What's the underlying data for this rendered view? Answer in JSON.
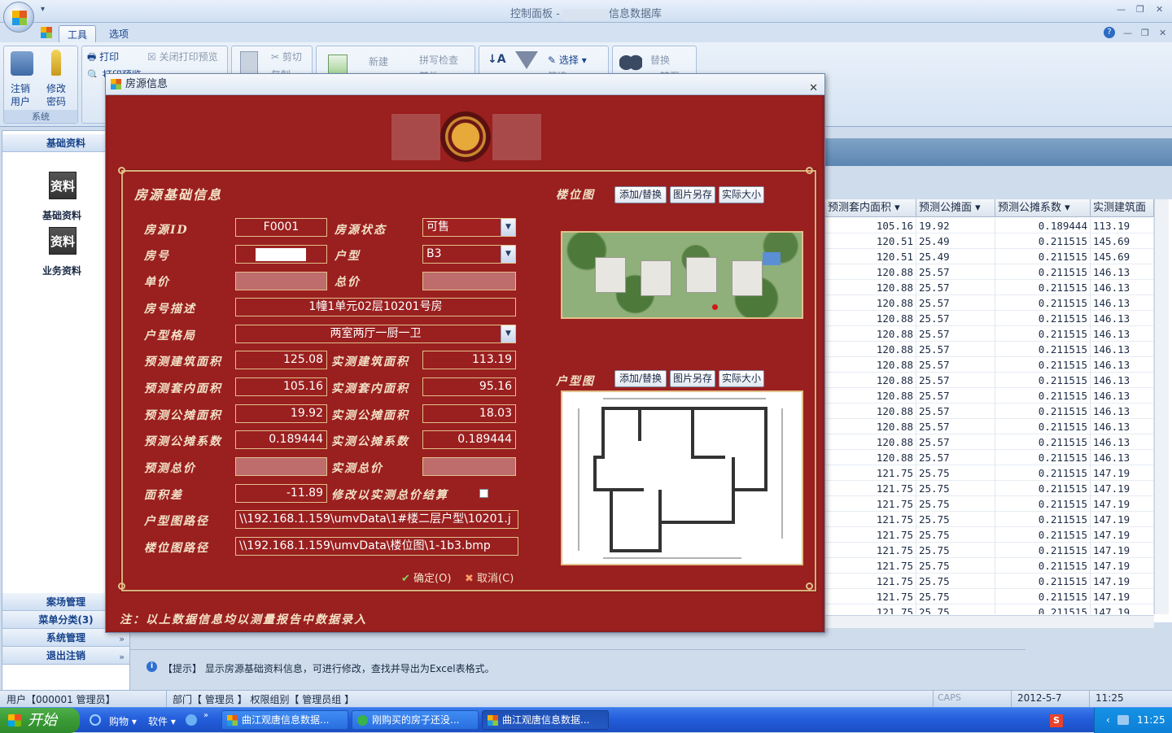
{
  "app": {
    "title_prefix": "控制面板 - ",
    "title_suffix": "信息数据库"
  },
  "tabs": [
    {
      "label": "工具"
    },
    {
      "label": "选项"
    }
  ],
  "ribbon": {
    "system_group": {
      "label": "系统",
      "logout": "注销\n用户",
      "change_pwd": "修改\n密码"
    },
    "print": "打印",
    "close_preview": "关闭打印预览",
    "preview": "打印预览",
    "cut": "剪切",
    "copy": "复制",
    "new": "新建",
    "spell": "拼写检查",
    "other": "其他",
    "select": "选择",
    "filter": "筛选",
    "replace": "替换",
    "goto": "转至"
  },
  "nav": {
    "header": "基础资料",
    "icon_text": "资料",
    "item1": "基础资料",
    "item2": "业务资料",
    "bottom": [
      {
        "label": "案场管理"
      },
      {
        "label": "菜单分类(3)"
      },
      {
        "label": "系统管理"
      },
      {
        "label": "退出注销"
      }
    ]
  },
  "grid": {
    "headers": [
      "预测套内面积",
      "预测公摊面",
      "预测公摊系数",
      "实测建筑面"
    ],
    "rows": [
      [
        "105.16",
        "19.92",
        "0.189444",
        "113.19"
      ],
      [
        "120.51",
        "25.49",
        "0.211515",
        "145.69"
      ],
      [
        "120.51",
        "25.49",
        "0.211515",
        "145.69"
      ],
      [
        "120.88",
        "25.57",
        "0.211515",
        "146.13"
      ],
      [
        "120.88",
        "25.57",
        "0.211515",
        "146.13"
      ],
      [
        "120.88",
        "25.57",
        "0.211515",
        "146.13"
      ],
      [
        "120.88",
        "25.57",
        "0.211515",
        "146.13"
      ],
      [
        "120.88",
        "25.57",
        "0.211515",
        "146.13"
      ],
      [
        "120.88",
        "25.57",
        "0.211515",
        "146.13"
      ],
      [
        "120.88",
        "25.57",
        "0.211515",
        "146.13"
      ],
      [
        "120.88",
        "25.57",
        "0.211515",
        "146.13"
      ],
      [
        "120.88",
        "25.57",
        "0.211515",
        "146.13"
      ],
      [
        "120.88",
        "25.57",
        "0.211515",
        "146.13"
      ],
      [
        "120.88",
        "25.57",
        "0.211515",
        "146.13"
      ],
      [
        "120.88",
        "25.57",
        "0.211515",
        "146.13"
      ],
      [
        "120.88",
        "25.57",
        "0.211515",
        "146.13"
      ],
      [
        "121.75",
        "25.75",
        "0.211515",
        "147.19"
      ],
      [
        "121.75",
        "25.75",
        "0.211515",
        "147.19"
      ],
      [
        "121.75",
        "25.75",
        "0.211515",
        "147.19"
      ],
      [
        "121.75",
        "25.75",
        "0.211515",
        "147.19"
      ],
      [
        "121.75",
        "25.75",
        "0.211515",
        "147.19"
      ],
      [
        "121.75",
        "25.75",
        "0.211515",
        "147.19"
      ],
      [
        "121.75",
        "25.75",
        "0.211515",
        "147.19"
      ],
      [
        "121.75",
        "25.75",
        "0.211515",
        "147.19"
      ],
      [
        "121.75",
        "25.75",
        "0.211515",
        "147.19"
      ],
      [
        "121.75",
        "25.75",
        "0.211515",
        "147.19"
      ]
    ]
  },
  "hint": "【提示】 显示房源基础资料信息，可进行修改，查找并导出为Excel表格式。",
  "status": {
    "user": "用户【000001 管理员】",
    "dept": "部门【 管理员 】 权限组别【 管理员组 】",
    "caps": "CAPS",
    "date": "2012-5-7",
    "time": "11:25"
  },
  "taskbar": {
    "start": "开始",
    "quick1": "购物",
    "quick2": "软件",
    "tasks": [
      {
        "label": "曲江观唐信息数据..."
      },
      {
        "label": "刚购买的房子还没..."
      },
      {
        "label": "曲江观唐信息数据..."
      }
    ],
    "clock": "11:25"
  },
  "dialog": {
    "title": "房源信息",
    "section": "房源基础信息",
    "labels": {
      "id": "房源ID",
      "status": "房源状态",
      "room_no": "房号",
      "layout_type": "户型",
      "unit_price": "单价",
      "total_price": "总价",
      "desc": "房号描述",
      "layout": "户型格局",
      "pred_build": "预测建筑面积",
      "real_build": "实测建筑面积",
      "pred_inner": "预测套内面积",
      "real_inner": "实测套内面积",
      "pred_share": "预测公摊面积",
      "real_share": "实测公摊面积",
      "pred_coef": "预测公摊系数",
      "real_coef": "实测公摊系数",
      "pred_total": "预测总价",
      "real_total": "实测总价",
      "area_diff": "面积差",
      "settle_check": "修改以实测总价结算",
      "layout_path": "户型图路径",
      "site_path": "楼位图路径"
    },
    "values": {
      "id": "F0001",
      "status": "可售",
      "layout_type": "B3",
      "desc": "1幢1单元02层10201号房",
      "layout": "两室两厅一厨一卫",
      "pred_build": "125.08",
      "real_build": "113.19",
      "pred_inner": "105.16",
      "real_inner": "95.16",
      "pred_share": "19.92",
      "real_share": "18.03",
      "pred_coef": "0.189444",
      "real_coef": "0.189444",
      "area_diff": "-11.89",
      "layout_path": "\\\\192.168.1.159\\umvData\\1#楼二层户型\\10201.j",
      "site_path": "\\\\192.168.1.159\\umvData\\楼位图\\1-1b3.bmp"
    },
    "site_map": {
      "label": "楼位图",
      "add": "添加/替换",
      "save": "图片另存",
      "actual": "实际大小"
    },
    "floor_plan": {
      "label": "户型图",
      "add": "添加/替换",
      "save": "图片另存",
      "actual": "实际大小"
    },
    "ok": "确定(O)",
    "cancel": "取消(C)",
    "note": "注：以上数据信息均以测量报告中数据录入"
  }
}
